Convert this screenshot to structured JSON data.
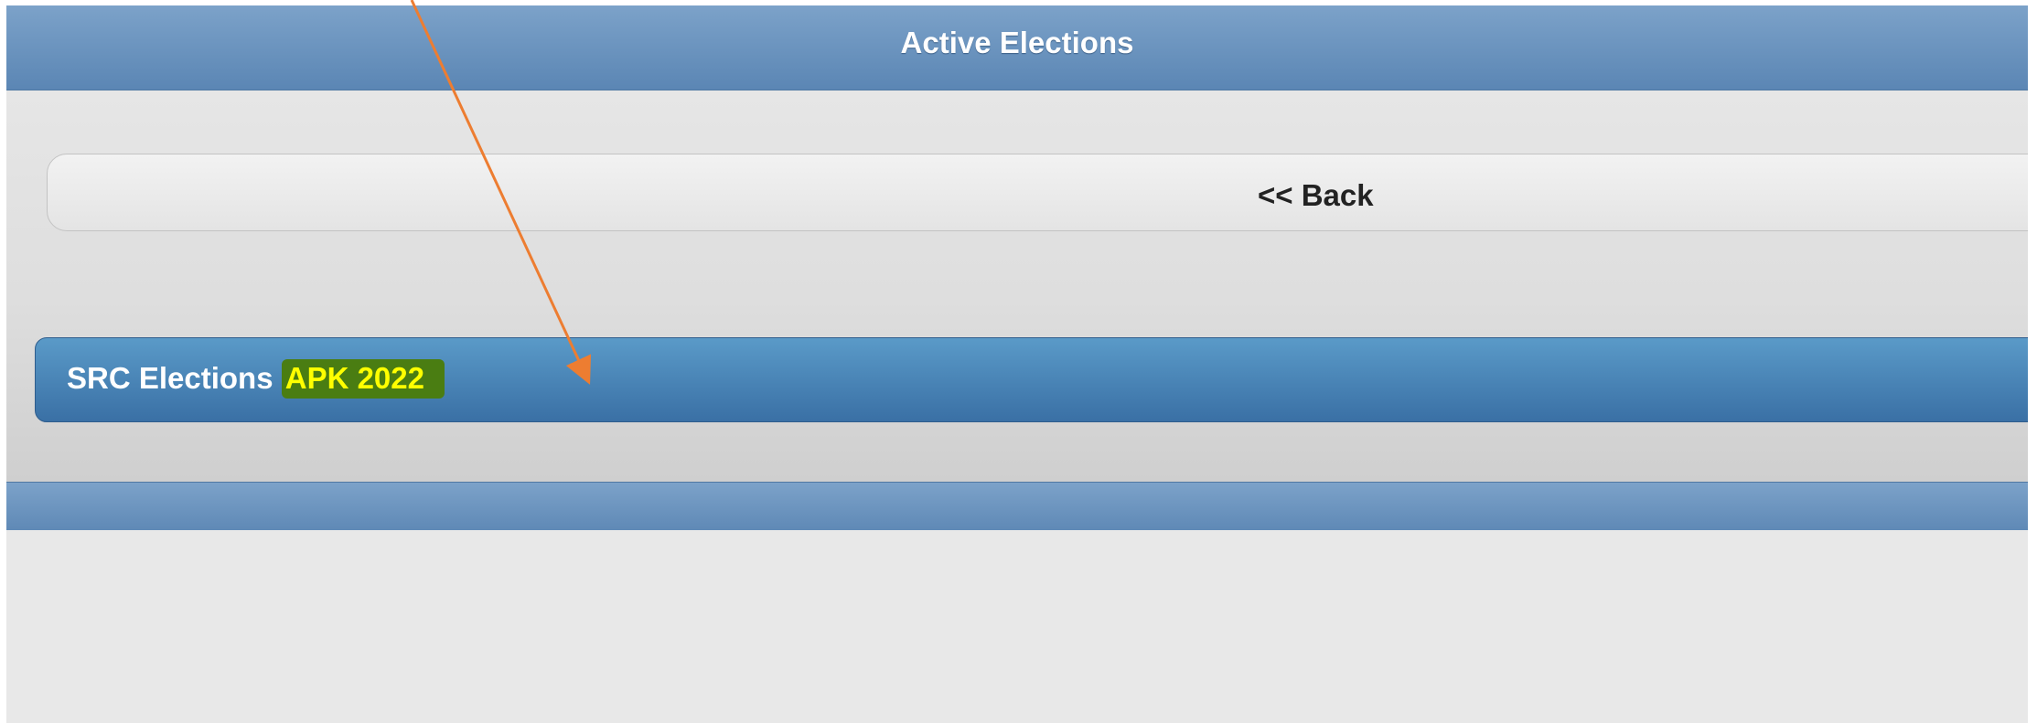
{
  "header": {
    "title": "Active Elections"
  },
  "back_button": {
    "label": "<< Back"
  },
  "elections": [
    {
      "name": "SRC Elections",
      "highlight": "APK 2022"
    }
  ],
  "annotation": {
    "arrow_color": "#ed7d31",
    "highlight_color": "#ffff00",
    "highlight_bg": "#4a7d12"
  }
}
